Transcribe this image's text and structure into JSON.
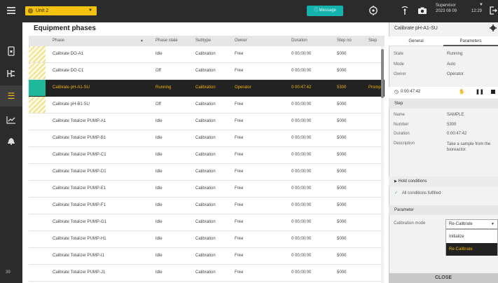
{
  "topbar": {
    "unit_label": "Unit 2",
    "message_label": "Message",
    "user_role": "Supervisor",
    "date": "2023 08 09",
    "time": "12:29"
  },
  "sidebar": {
    "footer": "39"
  },
  "main": {
    "title": "Equipment phases",
    "columns": [
      "Phase",
      "Phase state",
      "Subtype",
      "Owner",
      "Duration",
      "Step no",
      "Step"
    ],
    "rows": [
      {
        "phase": "Calibrate DO-A1",
        "state": "Idle",
        "subtype": "Calibration",
        "owner": "Free",
        "duration": "0 00:00:00",
        "step_no": "5000",
        "step": "",
        "marker": "stripe"
      },
      {
        "phase": "Calibrate DO-C1",
        "state": "Off",
        "subtype": "Calibration",
        "owner": "Free",
        "duration": "0 00:00:00",
        "step_no": "5000",
        "step": "",
        "marker": "stripe"
      },
      {
        "phase": "Calibrate pH-A1-SU",
        "state": "Running",
        "subtype": "Calibration",
        "owner": "Operator",
        "duration": "0 00:47:42",
        "step_no": "5300",
        "step": "Prompt",
        "marker": "teal"
      },
      {
        "phase": "Calibrate pH-B1-SU",
        "state": "Off",
        "subtype": "Calibration",
        "owner": "Free",
        "duration": "0 00:00:00",
        "step_no": "5000",
        "step": "",
        "marker": "stripe"
      },
      {
        "phase": "Calibrate Totalizer PUMP-A1",
        "state": "Idle",
        "subtype": "Calibration",
        "owner": "Free",
        "duration": "0 00:00:00",
        "step_no": "5000",
        "step": "",
        "marker": ""
      },
      {
        "phase": "Calibrate Totalizer PUMP-B1",
        "state": "Idle",
        "subtype": "Calibration",
        "owner": "Free",
        "duration": "0 00:00:00",
        "step_no": "5000",
        "step": "",
        "marker": ""
      },
      {
        "phase": "Calibrate Totalizer PUMP-C1",
        "state": "Idle",
        "subtype": "Calibration",
        "owner": "Free",
        "duration": "0 00:00:00",
        "step_no": "5000",
        "step": "",
        "marker": ""
      },
      {
        "phase": "Calibrate Totalizer PUMP-D1",
        "state": "Idle",
        "subtype": "Calibration",
        "owner": "Free",
        "duration": "0 00:00:00",
        "step_no": "5000",
        "step": "",
        "marker": ""
      },
      {
        "phase": "Calibrate Totalizer PUMP-E1",
        "state": "Idle",
        "subtype": "Calibration",
        "owner": "Free",
        "duration": "0 00:00:00",
        "step_no": "5000",
        "step": "",
        "marker": ""
      },
      {
        "phase": "Calibrate Totalizer PUMP-F1",
        "state": "Idle",
        "subtype": "Calibration",
        "owner": "Free",
        "duration": "0 00:00:00",
        "step_no": "5000",
        "step": "",
        "marker": ""
      },
      {
        "phase": "Calibrate Totalizer PUMP-G1",
        "state": "Idle",
        "subtype": "Calibration",
        "owner": "Free",
        "duration": "0 00:00:00",
        "step_no": "5000",
        "step": "",
        "marker": ""
      },
      {
        "phase": "Calibrate Totalizer PUMP-H1",
        "state": "Idle",
        "subtype": "Calibration",
        "owner": "Free",
        "duration": "0 00:00:00",
        "step_no": "5000",
        "step": "",
        "marker": ""
      },
      {
        "phase": "Calibrate Totalizer PUMP-I1",
        "state": "Idle",
        "subtype": "Calibration",
        "owner": "Free",
        "duration": "0 00:00:00",
        "step_no": "5000",
        "step": "",
        "marker": ""
      },
      {
        "phase": "Calibrate Totalizer PUMP-J1",
        "state": "Idle",
        "subtype": "Calibration",
        "owner": "Free",
        "duration": "0 00:00:00",
        "step_no": "5000",
        "step": "",
        "marker": ""
      }
    ]
  },
  "panel": {
    "title": "Calibrate pH-A1-SU",
    "tabs": [
      "General",
      "Parameters"
    ],
    "state_label": "State",
    "state_value": "Running",
    "mode_label": "Mode",
    "mode_value": "Auto",
    "owner_label": "Owner",
    "owner_value": "Operator",
    "elapsed": "0:00:47:42",
    "step_section": "Step",
    "name_label": "Name",
    "name_value": "SAMPLE",
    "number_label": "Number",
    "number_value": "5300",
    "duration_label": "Duration",
    "duration_value": "0:00:47:42",
    "description_label": "Description",
    "description_value": "Take a sample from the bioreactor.",
    "hold_conditions": "Hold conditions",
    "conditions_status": "All conditions fulfilled",
    "parameter_section": "Parameter",
    "calibration_mode_label": "Calibration mode",
    "calibration_mode_value": "Re-Calibrate",
    "options": [
      "Initialize",
      "Re-Calibrate"
    ],
    "close_label": "CLOSE"
  },
  "colors": {
    "accent": "#f2c20f",
    "selected_text": "#f0b400",
    "message": "#14b2ad",
    "running_marker": "#1fb89a"
  }
}
